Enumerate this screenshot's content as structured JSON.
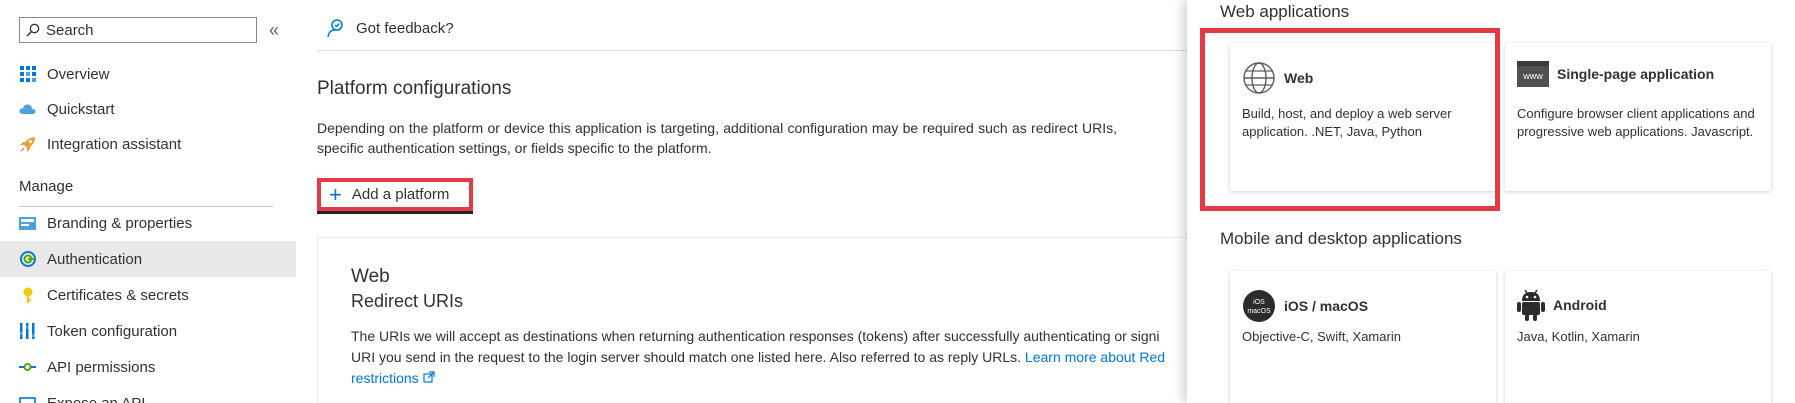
{
  "sidebar": {
    "search_placeholder": "Search",
    "collapse_glyph": "«",
    "items": [
      {
        "label": "Overview",
        "icon": "grid-icon"
      },
      {
        "label": "Quickstart",
        "icon": "cloud-icon"
      },
      {
        "label": "Integration assistant",
        "icon": "rocket-icon"
      }
    ],
    "manage_header": "Manage",
    "manage_items": [
      {
        "label": "Branding & properties",
        "icon": "branding-icon"
      },
      {
        "label": "Authentication",
        "icon": "authentication-icon",
        "active": true
      },
      {
        "label": "Certificates & secrets",
        "icon": "key-icon"
      },
      {
        "label": "Token configuration",
        "icon": "token-icon"
      },
      {
        "label": "API permissions",
        "icon": "api-permissions-icon"
      },
      {
        "label": "Expose an API",
        "icon": "expose-api-icon"
      }
    ]
  },
  "main": {
    "feedback": "Got feedback?",
    "title": "Platform configurations",
    "description": "Depending on the platform or device this application is targeting, additional configuration may be required such as redirect URIs, specific authentication settings, or fields specific to the platform.",
    "add_platform": "Add a platform",
    "web_card": {
      "title": "Web",
      "subtitle": "Redirect URIs",
      "body": "The URIs we will accept as destinations when returning authentication responses (tokens) after successfully authenticating or signi",
      "body2": "URI you send in the request to the login server should match one listed here. Also referred to as reply URLs.",
      "link": "Learn more about Red",
      "link2": "restrictions"
    }
  },
  "panel": {
    "web_header": "Web applications",
    "mobile_header": "Mobile and desktop applications",
    "tiles": {
      "web": {
        "name": "Web",
        "desc": "Build, host, and deploy a web server application. .NET, Java, Python"
      },
      "spa": {
        "name": "Single-page application",
        "desc": "Configure browser client applications and progressive web applications. Javascript.",
        "badge": "www"
      },
      "ios": {
        "name": "iOS / macOS",
        "desc": "Objective-C, Swift, Xamarin",
        "badge_line1": "iOS",
        "badge_line2": "macOS"
      },
      "android": {
        "name": "Android",
        "desc": "Java, Kotlin, Xamarin"
      }
    }
  },
  "colors": {
    "accent": "#0078d4",
    "highlight": "#e63946",
    "active_bg": "#e9e9e9"
  }
}
